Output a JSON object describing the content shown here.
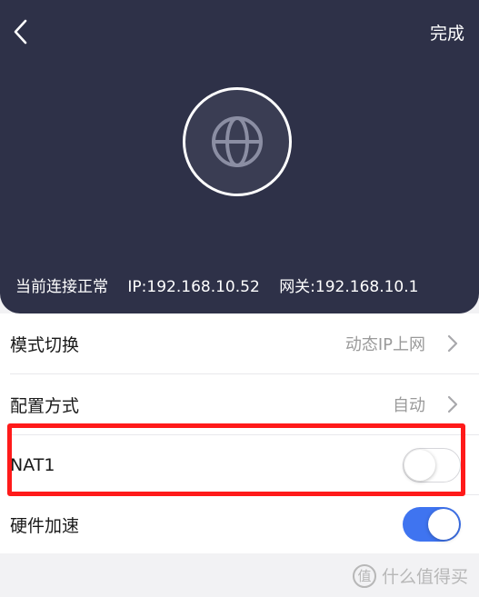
{
  "header": {
    "done_label": "完成",
    "status": {
      "connection": "当前连接正常",
      "ip": "IP:192.168.10.52",
      "gateway": "网关:192.168.10.1"
    }
  },
  "settings": {
    "mode": {
      "label": "模式切换",
      "value": "动态IP上网"
    },
    "config": {
      "label": "配置方式",
      "value": "自动"
    },
    "nat1": {
      "label": "NAT1",
      "enabled": false
    },
    "hw_accel": {
      "label": "硬件加速",
      "enabled": true
    }
  },
  "watermark": {
    "logo_char": "值",
    "text": "什么值得买"
  },
  "colors": {
    "header_bg": "#2e3148",
    "toggle_on": "#3f74f0",
    "highlight": "#ff1a1a"
  },
  "icons": [
    "chevron-left-icon",
    "globe-icon",
    "chevron-right-icon"
  ]
}
